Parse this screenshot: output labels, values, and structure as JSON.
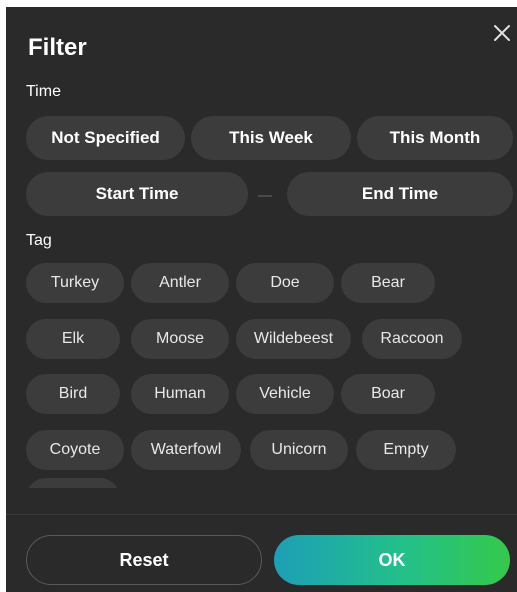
{
  "header": {
    "title": "Filter",
    "close_icon": "close-icon"
  },
  "time": {
    "label": "Time",
    "presets": [
      "Not Specified",
      "This Week",
      "This Month"
    ],
    "start_label": "Start Time",
    "end_label": "End Time"
  },
  "tag": {
    "label": "Tag",
    "items": [
      "Turkey",
      "Antler",
      "Doe",
      "Bear",
      "Elk",
      "Moose",
      "Wildebeest",
      "Raccoon",
      "Bird",
      "Human",
      "Vehicle",
      "Boar",
      "Coyote",
      "Waterfowl",
      "Unicorn",
      "Empty"
    ]
  },
  "footer": {
    "reset_label": "Reset",
    "ok_label": "OK"
  },
  "colors": {
    "panel_background": "#2a2a2a",
    "pill_background": "#3c3c3c",
    "ok_gradient_start": "#1d9fb6",
    "ok_gradient_end": "#35c94a"
  }
}
